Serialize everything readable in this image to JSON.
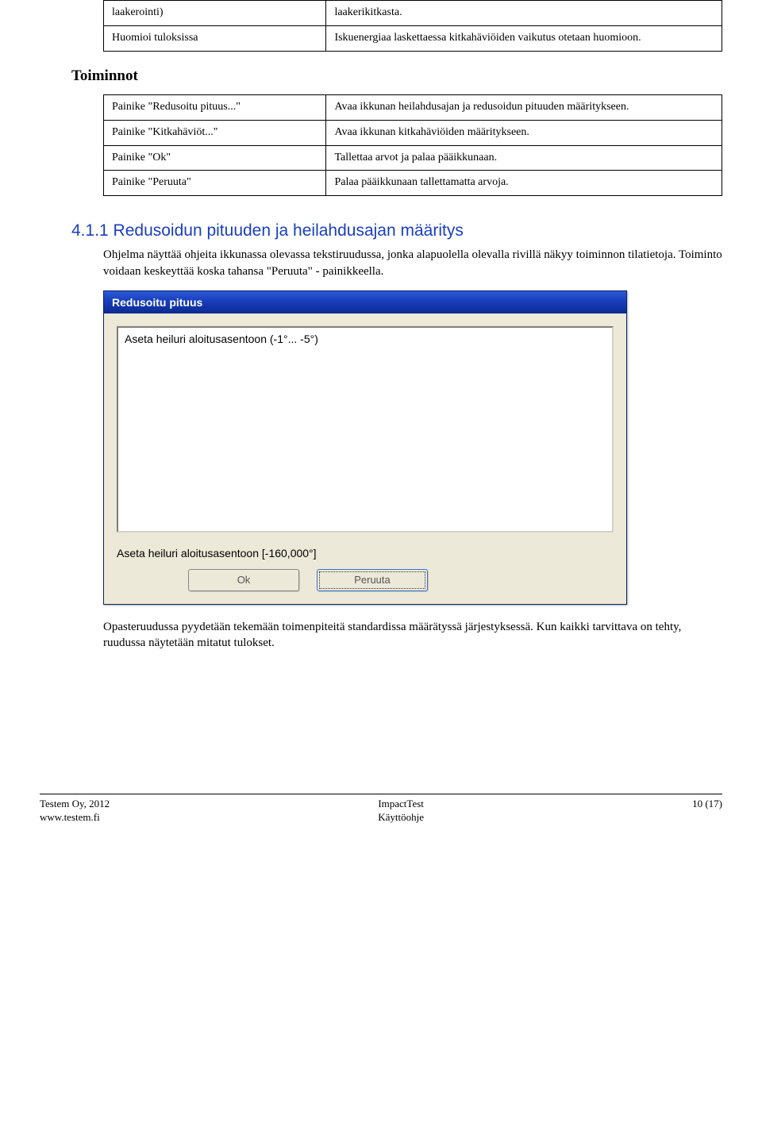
{
  "table1": {
    "rows": [
      {
        "term": "laakerointi)",
        "desc": "laakerikitkasta."
      },
      {
        "term": "Huomioi tuloksissa",
        "desc": "Iskuenergiaa laskettaessa kitkahäviöiden vaikutus otetaan huomioon."
      }
    ]
  },
  "toiminnot_heading": "Toiminnot",
  "table2": {
    "rows": [
      {
        "term": "Painike \"Redusoitu pituus...\"",
        "desc": "Avaa ikkunan heilahdusajan ja redusoidun pituuden määritykseen."
      },
      {
        "term": "Painike \"Kitkahäviöt...\"",
        "desc": "Avaa ikkunan kitkahäviöiden määritykseen."
      },
      {
        "term": "Painike \"Ok\"",
        "desc": "Tallettaa arvot ja palaa pääikkunaan."
      },
      {
        "term": "Painike \"Peruuta\"",
        "desc": "Palaa pääikkunaan tallettamatta arvoja."
      }
    ]
  },
  "section": {
    "heading": "4.1.1  Redusoidun pituuden ja heilahdusajan määritys",
    "para1": "Ohjelma näyttää ohjeita ikkunassa olevassa tekstiruudussa, jonka alapuolella olevalla rivillä näkyy toiminnon tilatietoja. Toiminto voidaan keskeyttää koska tahansa \"Peruuta\" - painikkeella."
  },
  "dialog": {
    "title": "Redusoitu pituus",
    "textbox_value": "Aseta heiluri aloitusasentoon (-1°... -5°)",
    "status": "Aseta heiluri aloitusasentoon [-160,000°]",
    "ok_label": "Ok",
    "cancel_label": "Peruuta"
  },
  "para2": "Opasteruudussa pyydetään tekemään toimenpiteitä standardissa määrätyssä järjestyksessä. Kun kaikki tarvittava on tehty, ruudussa näytetään mitatut tulokset.",
  "footer": {
    "left1": "Testem Oy, 2012",
    "left2": "www.testem.fi",
    "center1": "ImpactTest",
    "center2": "Käyttöohje",
    "right": "10 (17)"
  }
}
